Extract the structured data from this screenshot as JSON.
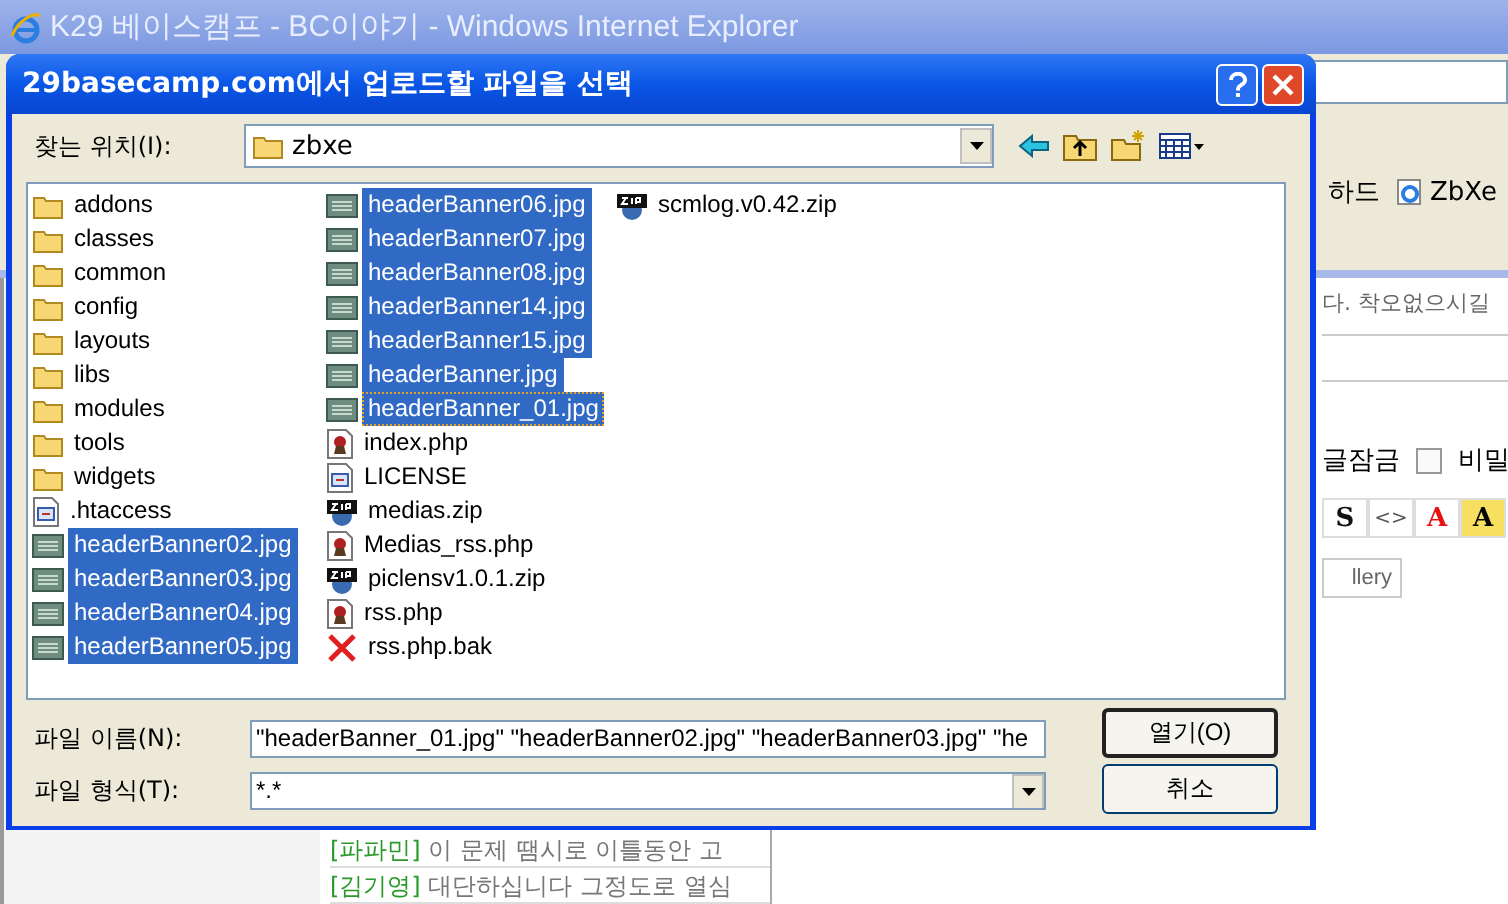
{
  "browser": {
    "title": "K29 베이스캠프 - BC이야기 - Windows Internet Explorer",
    "links": [
      {
        "label": "하드",
        "kind": "plain"
      },
      {
        "label": "ZbXe",
        "kind": "ie"
      }
    ],
    "notice": "다. 착오없으시길",
    "options": [
      {
        "label": "글잠금",
        "kind": "text"
      },
      {
        "label": "비밀",
        "kind": "checkbox",
        "checked": false
      }
    ],
    "format_buttons": [
      {
        "kind": "strike",
        "label": "S"
      },
      {
        "kind": "code",
        "label": "<>"
      },
      {
        "kind": "color",
        "label": "A"
      },
      {
        "kind": "highlight",
        "label": "A"
      }
    ],
    "gallery_button": "llery",
    "comments": [
      {
        "author": "[파파민]",
        "text": "이 문제 땜시로 이틀동안 고"
      },
      {
        "author": "[김기영]",
        "text": "대단하십니다 그정도로 열심"
      }
    ]
  },
  "dialog": {
    "title": "29basecamp.com에서 업로드할 파일을 선택",
    "look_in_label": "찾는 위치(I):",
    "look_in_value": "zbxe",
    "files": [
      {
        "name": "addons",
        "kind": "folder",
        "selected": false,
        "focused": false
      },
      {
        "name": "classes",
        "kind": "folder",
        "selected": false,
        "focused": false
      },
      {
        "name": "common",
        "kind": "folder",
        "selected": false,
        "focused": false
      },
      {
        "name": "config",
        "kind": "folder",
        "selected": false,
        "focused": false
      },
      {
        "name": "layouts",
        "kind": "folder",
        "selected": false,
        "focused": false
      },
      {
        "name": "libs",
        "kind": "folder",
        "selected": false,
        "focused": false
      },
      {
        "name": "modules",
        "kind": "folder",
        "selected": false,
        "focused": false
      },
      {
        "name": "tools",
        "kind": "folder",
        "selected": false,
        "focused": false
      },
      {
        "name": "widgets",
        "kind": "folder",
        "selected": false,
        "focused": false
      },
      {
        "name": ".htaccess",
        "kind": "text",
        "selected": false,
        "focused": false
      },
      {
        "name": "headerBanner02.jpg",
        "kind": "image",
        "selected": true,
        "focused": false
      },
      {
        "name": "headerBanner03.jpg",
        "kind": "image",
        "selected": true,
        "focused": false
      },
      {
        "name": "headerBanner04.jpg",
        "kind": "image",
        "selected": true,
        "focused": false
      },
      {
        "name": "headerBanner05.jpg",
        "kind": "image",
        "selected": true,
        "focused": false
      },
      {
        "name": "headerBanner06.jpg",
        "kind": "image",
        "selected": true,
        "focused": false
      },
      {
        "name": "headerBanner07.jpg",
        "kind": "image",
        "selected": true,
        "focused": false
      },
      {
        "name": "headerBanner08.jpg",
        "kind": "image",
        "selected": true,
        "focused": false
      },
      {
        "name": "headerBanner14.jpg",
        "kind": "image",
        "selected": true,
        "focused": false
      },
      {
        "name": "headerBanner15.jpg",
        "kind": "image",
        "selected": true,
        "focused": false
      },
      {
        "name": "headerBanner.jpg",
        "kind": "image",
        "selected": true,
        "focused": false
      },
      {
        "name": "headerBanner_01.jpg",
        "kind": "image",
        "selected": true,
        "focused": true
      },
      {
        "name": "index.php",
        "kind": "script",
        "selected": false,
        "focused": false
      },
      {
        "name": "LICENSE",
        "kind": "text",
        "selected": false,
        "focused": false
      },
      {
        "name": "medias.zip",
        "kind": "zip",
        "selected": false,
        "focused": false
      },
      {
        "name": "Medias_rss.php",
        "kind": "script",
        "selected": false,
        "focused": false
      },
      {
        "name": "piclensv1.0.1.zip",
        "kind": "zip",
        "selected": false,
        "focused": false
      },
      {
        "name": "rss.php",
        "kind": "script",
        "selected": false,
        "focused": false
      },
      {
        "name": "rss.php.bak",
        "kind": "unknown",
        "selected": false,
        "focused": false
      },
      {
        "name": "scmlog.v0.42.zip",
        "kind": "zip",
        "selected": false,
        "focused": false
      }
    ],
    "filename_label": "파일 이름(N):",
    "filename_value": "\"headerBanner_01.jpg\" \"headerBanner02.jpg\" \"headerBanner03.jpg\" \"he",
    "filetype_label": "파일 형식(T):",
    "filetype_value": "*.*",
    "buttons": [
      "열기(O)",
      "취소"
    ]
  }
}
